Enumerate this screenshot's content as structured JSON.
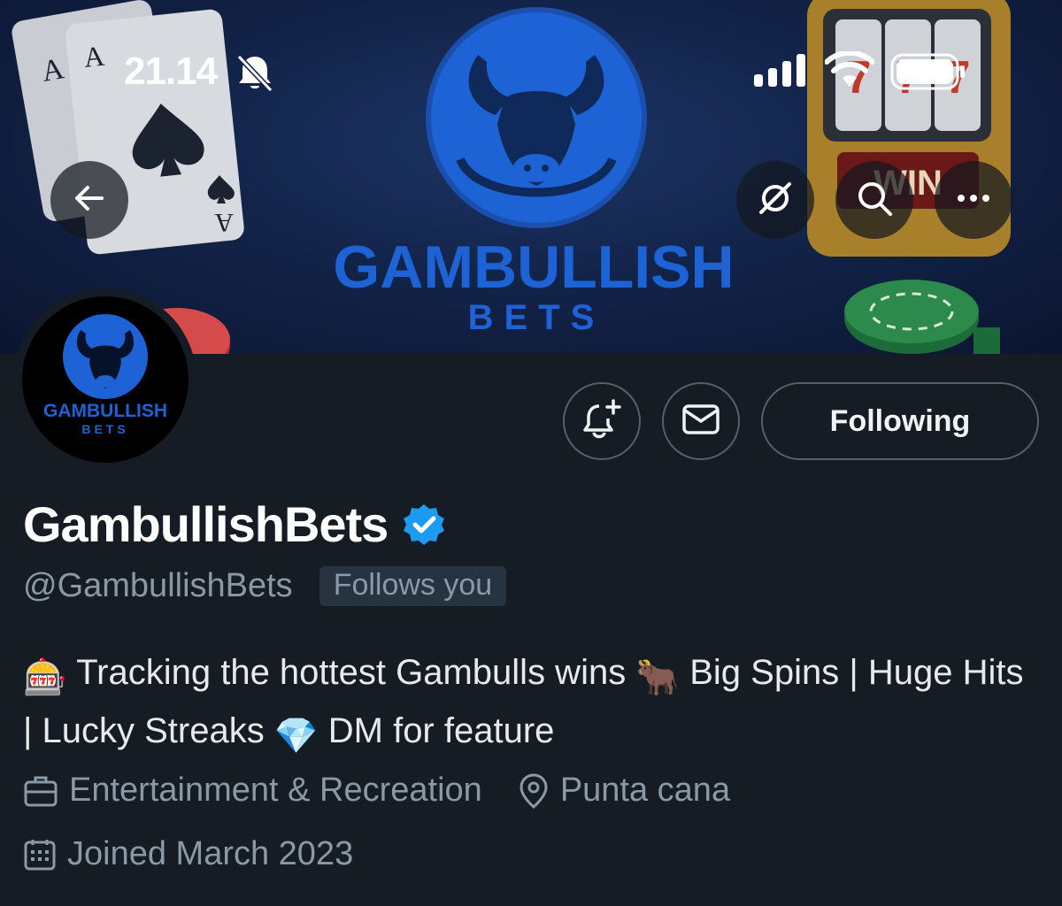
{
  "status_bar": {
    "time": "21.14",
    "icons": [
      "bell-slash-icon",
      "cellular-signal-icon",
      "wifi-icon",
      "battery-icon"
    ]
  },
  "banner": {
    "title": "GAMBULLISH",
    "subtitle": "BETS",
    "decor": [
      "playing-cards",
      "bull-logo",
      "slot-machine",
      "poker-chips"
    ],
    "slot_sign": "WIN"
  },
  "nav": {
    "back_icon": "arrow-left-icon",
    "grok_icon": "grok-icon",
    "search_icon": "search-icon",
    "more_icon": "more-icon"
  },
  "avatar": {
    "line1": "GAMBULLISH",
    "line2": "BETS"
  },
  "actions": {
    "notify_icon": "bell-plus-icon",
    "message_icon": "envelope-icon",
    "following_label": "Following"
  },
  "profile": {
    "display_name": "GambullishBets",
    "verified": true,
    "handle": "@GambullishBets",
    "follows_you": "Follows you",
    "bio_emoji_1": "🎰",
    "bio_text_1": " Tracking the hottest Gambulls wins ",
    "bio_emoji_2": "🐂",
    "bio_text_2": " Big Spins | Huge Hits | Lucky Streaks ",
    "bio_emoji_3": "💎",
    "bio_text_3": " DM for feature",
    "category": "Entertainment & Recreation",
    "location": "Punta cana",
    "joined": "Joined March 2023"
  },
  "colors": {
    "background": "#151c24",
    "brand_blue": "#1d63d6",
    "verified_blue": "#1d9bf0",
    "secondary_text": "#8b98a5"
  }
}
